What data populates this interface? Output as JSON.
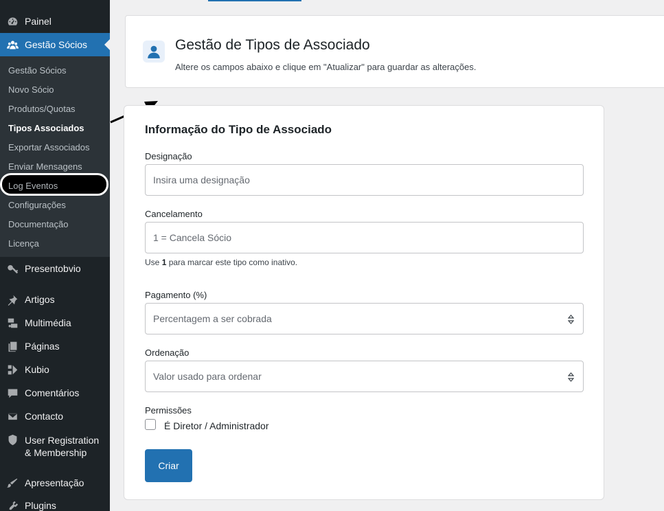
{
  "sidebar": {
    "top_items": [
      {
        "label": "Painel",
        "icon": "dashboard-icon"
      },
      {
        "label": "Gestão Sócios",
        "icon": "groups-icon"
      }
    ],
    "submenu": [
      {
        "label": "Gestão Sócios"
      },
      {
        "label": "Novo Sócio"
      },
      {
        "label": "Produtos/Quotas"
      },
      {
        "label": "Tipos Associados"
      },
      {
        "label": "Exportar Associados"
      },
      {
        "label": "Enviar Mensagens"
      },
      {
        "label": "Log Eventos"
      },
      {
        "label": "Configurações"
      },
      {
        "label": "Documentação"
      },
      {
        "label": "Licença"
      }
    ],
    "bottom_items": [
      {
        "label": "Presentobvio",
        "icon": "key-icon"
      },
      {
        "label": "Artigos",
        "icon": "pin-icon"
      },
      {
        "label": "Multimédia",
        "icon": "media-icon"
      },
      {
        "label": "Páginas",
        "icon": "page-icon"
      },
      {
        "label": "Kubio",
        "icon": "kubio-icon"
      },
      {
        "label": "Comentários",
        "icon": "comment-icon"
      },
      {
        "label": "Contacto",
        "icon": "mail-icon"
      },
      {
        "label": "User Registration\n& Membership",
        "icon": "user-registration-icon"
      },
      {
        "label": "Apresentação",
        "icon": "brush-icon"
      },
      {
        "label": "Plugins",
        "icon": "plugin-icon"
      }
    ]
  },
  "header": {
    "title": "Gestão de Tipos de Associado",
    "subtitle": "Altere os campos abaixo e clique em \"Atualizar\" para guardar as alterações.",
    "icon": "user-icon"
  },
  "form": {
    "title": "Informação do Tipo de Associado",
    "designacao": {
      "label": "Designação",
      "placeholder": "Insira uma designação"
    },
    "cancelamento": {
      "label": "Cancelamento",
      "placeholder": "1 = Cancela Sócio"
    },
    "help": {
      "prefix": "Use ",
      "strong": "1",
      "suffix": " para marcar este tipo como inativo."
    },
    "pagamento": {
      "label": "Pagamento (%)",
      "placeholder": "Percentagem a ser cobrada"
    },
    "ordenacao": {
      "label": "Ordenação",
      "placeholder": "Valor usado para ordenar"
    },
    "permissoes": {
      "label": "Permissões",
      "checkbox_label": "É Diretor / Administrador",
      "checked": false
    },
    "submit_label": "Criar"
  },
  "colors": {
    "accent": "#2271b1",
    "sidebar_bg": "#1d2327",
    "submenu_bg": "#2c3338"
  }
}
